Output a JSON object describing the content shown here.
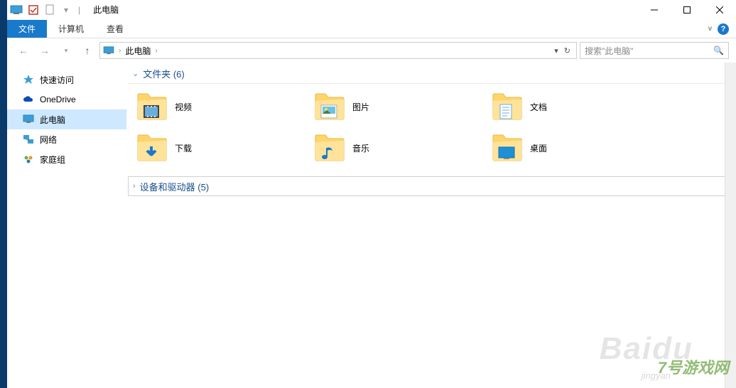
{
  "titlebar": {
    "title": "此电脑",
    "sep": "|"
  },
  "ribbon": {
    "tabs": [
      {
        "label": "文件",
        "active": true
      },
      {
        "label": "计算机",
        "active": false
      },
      {
        "label": "查看",
        "active": false
      }
    ]
  },
  "nav": {
    "breadcrumb": "此电脑",
    "search_placeholder": "搜索\"此电脑\""
  },
  "sidebar": {
    "items": [
      {
        "label": "快速访问",
        "icon": "star"
      },
      {
        "label": "OneDrive",
        "icon": "cloud"
      },
      {
        "label": "此电脑",
        "icon": "pc",
        "selected": true
      },
      {
        "label": "网络",
        "icon": "network"
      },
      {
        "label": "家庭组",
        "icon": "homegroup"
      }
    ]
  },
  "content": {
    "group1": {
      "title": "文件夹 (6)",
      "expanded": true
    },
    "group2": {
      "title": "设备和驱动器 (5)",
      "expanded": false
    },
    "folders": [
      {
        "label": "视频",
        "overlay": "video"
      },
      {
        "label": "图片",
        "overlay": "pictures"
      },
      {
        "label": "文档",
        "overlay": "documents"
      },
      {
        "label": "下载",
        "overlay": "downloads"
      },
      {
        "label": "音乐",
        "overlay": "music"
      },
      {
        "label": "桌面",
        "overlay": "desktop"
      }
    ]
  },
  "watermarks": {
    "w1": "Baidu",
    "w2": "7号游戏网",
    "w3": "jingyan"
  }
}
